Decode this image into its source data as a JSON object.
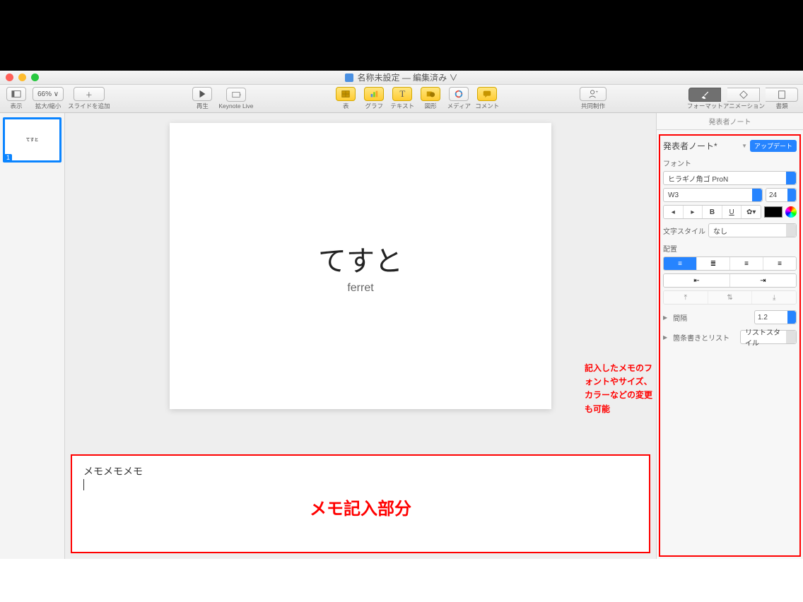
{
  "window": {
    "title": "名称未設定 — 編集済み ∨"
  },
  "toolbar": {
    "view": "表示",
    "zoom_value": "66% ∨",
    "zoom": "拡大/縮小",
    "add_slide": "スライドを追加",
    "play": "再生",
    "keynote_live": "Keynote Live",
    "table": "表",
    "chart": "グラフ",
    "text": "テキスト",
    "shape": "図形",
    "media": "メディア",
    "comment": "コメント",
    "collaborate": "共同制作",
    "format": "フォーマット",
    "animation": "アニメーション",
    "document": "書類"
  },
  "thumb": {
    "slide_number": "1",
    "title": "てすと"
  },
  "slide": {
    "title": "てすと",
    "subtitle": "ferret"
  },
  "notes": {
    "content": "メモメモメモ",
    "label": "メモ記入部分"
  },
  "annotation": {
    "line1": "記入したメモのフォントやサイズ、",
    "line2": "カラーなどの変更も可能"
  },
  "inspector": {
    "tab_label": "発表者ノート",
    "title": "発表者ノート*",
    "update_btn": "アップデート",
    "font_label": "フォント",
    "font_family": "ヒラギノ角ゴ ProN",
    "font_weight": "W3",
    "font_size": "24",
    "char_style_label": "文字スタイル",
    "char_style_value": "なし",
    "align_label": "配置",
    "spacing_label": "間隔",
    "spacing_value": "1.2",
    "bullets_label": "箇条書きとリスト",
    "bullets_value": "リストスタイル"
  },
  "style_btns": {
    "b": "B",
    "u": "U"
  }
}
